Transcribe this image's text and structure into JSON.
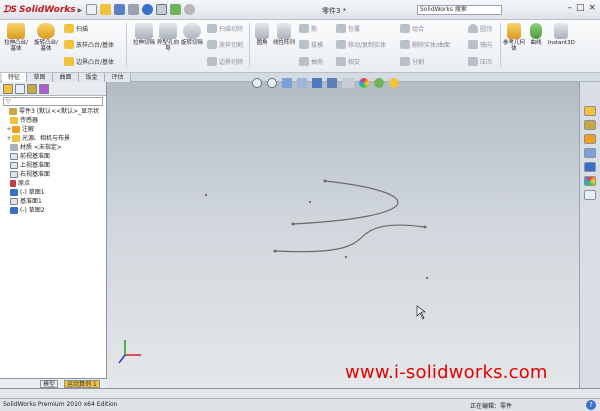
{
  "app": {
    "logo_text": "SolidWorks",
    "doc_title": "零件3 *",
    "search_placeholder": "SolidWorks 搜索",
    "watermark": "www.i-solidworks.com",
    "status_left": "SolidWorks Premium 2010 x64 Edition",
    "status_right": "正在编辑：零件",
    "help_glyph": "?"
  },
  "window_buttons": [
    "–",
    "□",
    "×"
  ],
  "ribbon": {
    "extrude_boss": "拉伸凸台/基体",
    "revolve_boss": "旋转凸台/基体",
    "sweep": "扫描",
    "loft": "放样凸台/基体",
    "boundary_boss": "边界凸台/基体",
    "extrude_cut": "拉伸切除",
    "hole_wizard": "异型孔向导",
    "revolve_cut": "旋转切除",
    "sweep_cut": "扫描切除",
    "loft_cut": "放样切割",
    "boundary_cut": "边界切除",
    "fillet": "圆角",
    "linear_pattern": "线性阵列",
    "rib": "筋",
    "draft": "拔模",
    "shell": "抽壳",
    "wrap": "包覆",
    "intersect": "相交",
    "mirror": "镜向",
    "move_copy": "移动/复制实体",
    "delete_body": "删除实体/曲面",
    "combine": "组合",
    "split": "分割",
    "dome": "圆顶",
    "indent": "压凹",
    "ref_geometry": "参考几何体",
    "curves": "曲线",
    "instant3d": "Instant3D"
  },
  "cm_tabs": [
    "特征",
    "草图",
    "曲面",
    "钣金",
    "评估"
  ],
  "feature_tree": {
    "filter_icon": "funnel-icon",
    "items": [
      {
        "label": "零件3 (默认<<默认>_显示状",
        "expander": ""
      },
      {
        "label": "传感器",
        "expander": ""
      },
      {
        "label": "注解",
        "expander": "+"
      },
      {
        "label": "光源、相机与布景",
        "expander": "+"
      },
      {
        "label": "材质 <未指定>",
        "expander": ""
      },
      {
        "label": "前视基准面",
        "expander": ""
      },
      {
        "label": "上视基准面",
        "expander": ""
      },
      {
        "label": "右视基准面",
        "expander": ""
      },
      {
        "label": "原点",
        "expander": ""
      },
      {
        "label": "(-) 草图1",
        "expander": ""
      },
      {
        "label": "基准面1",
        "expander": ""
      },
      {
        "label": "(-) 草图2",
        "expander": ""
      }
    ]
  },
  "bottom_tabs": [
    "模型",
    "运动算例 1"
  ],
  "icons": {
    "colors": {
      "accent_red": "#e30000",
      "ribbon_yellow": "#f3c23c",
      "ribbon_blue": "#6e8fc4",
      "ribbon_purple": "#9f6bb8",
      "ribbon_green": "#6fb35a",
      "graphics_top": "#b3bcc5",
      "graphics_bottom": "#e4e7ea"
    }
  }
}
